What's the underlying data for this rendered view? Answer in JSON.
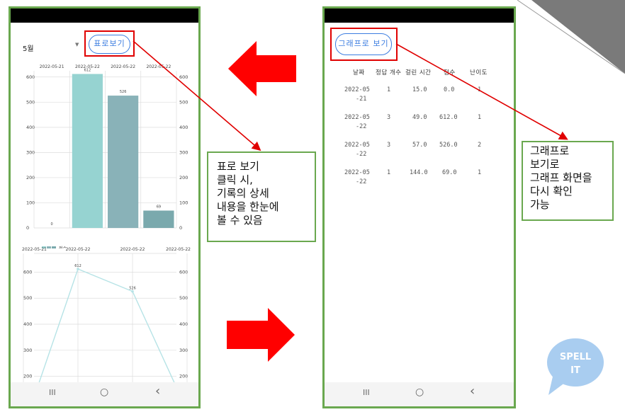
{
  "left_phone": {
    "month_select": "5월",
    "table_view_button": "표로보기",
    "bar_chart": {
      "top_dates": [
        "2022-05-21",
        "2022-05-22",
        "2022-05-22",
        "2022-05-22"
      ],
      "left_ticks": [
        "600",
        "500",
        "400",
        "300",
        "200",
        "100",
        "0"
      ],
      "right_ticks": [
        "600",
        "500",
        "400",
        "300",
        "200",
        "100",
        "0"
      ],
      "bar_labels": [
        "0",
        "612",
        "526",
        "69"
      ],
      "legend": "점수"
    },
    "line_chart": {
      "top_dates": [
        "2022-05-21",
        "2022-05-22",
        "2022-05-22",
        "2022-05-22"
      ],
      "left_ticks": [
        "600",
        "500",
        "400",
        "300",
        "200"
      ],
      "right_ticks": [
        "600",
        "500",
        "400",
        "300",
        "200"
      ],
      "point_labels": [
        "612",
        "526"
      ]
    }
  },
  "right_phone": {
    "graph_view_button": "그래프로 보기",
    "table": {
      "headers": [
        "날짜",
        "정답 개수",
        "걸린 시간",
        "점수",
        "난이도"
      ],
      "rows": [
        {
          "date1": "2022-05",
          "date2": "-21",
          "correct": "1",
          "time": "15.0",
          "score": "0.0",
          "level": "1"
        },
        {
          "date1": "2022-05",
          "date2": "-22",
          "correct": "3",
          "time": "49.0",
          "score": "612.0",
          "level": "1"
        },
        {
          "date1": "2022-05",
          "date2": "-22",
          "correct": "3",
          "time": "57.0",
          "score": "526.0",
          "level": "2"
        },
        {
          "date1": "2022-05",
          "date2": "-22",
          "correct": "1",
          "time": "144.0",
          "score": "69.0",
          "level": "1"
        }
      ]
    }
  },
  "nav": {
    "recent": "III",
    "home": "○",
    "back": "‹"
  },
  "notes": {
    "left": [
      "표로 보기",
      "클릭 시,",
      "기록의 상세",
      "내용을 한눈에",
      "볼 수 있음"
    ],
    "right": [
      "그래프로",
      "보기로",
      "그래프 화면을",
      "다시 확인",
      "가능"
    ]
  },
  "logo": {
    "line1": "SPELL",
    "line2": "IT"
  },
  "chart_data": [
    {
      "type": "bar",
      "categories": [
        "2022-05-21",
        "2022-05-22",
        "2022-05-22",
        "2022-05-22"
      ],
      "series": [
        {
          "name": "점수",
          "values": [
            0,
            612,
            526,
            69
          ]
        }
      ],
      "ylim": [
        0,
        650
      ],
      "grid": true,
      "legend": "bottom-left"
    },
    {
      "type": "line",
      "categories": [
        "2022-05-21",
        "2022-05-22",
        "2022-05-22",
        "2022-05-22"
      ],
      "series": [
        {
          "name": "점수",
          "values": [
            0,
            612,
            526,
            69
          ]
        }
      ],
      "ylim": [
        180,
        650
      ],
      "grid": true
    }
  ],
  "colors": {
    "frame": "#6aa84f",
    "highlight": "#e00000",
    "button": "#3c7de0",
    "bar1": "#96d3d1",
    "bar2": "#89b2b8",
    "bar3": "#7aa9ad",
    "line": "#b6e3e6",
    "logo": "#a9cdf0"
  }
}
